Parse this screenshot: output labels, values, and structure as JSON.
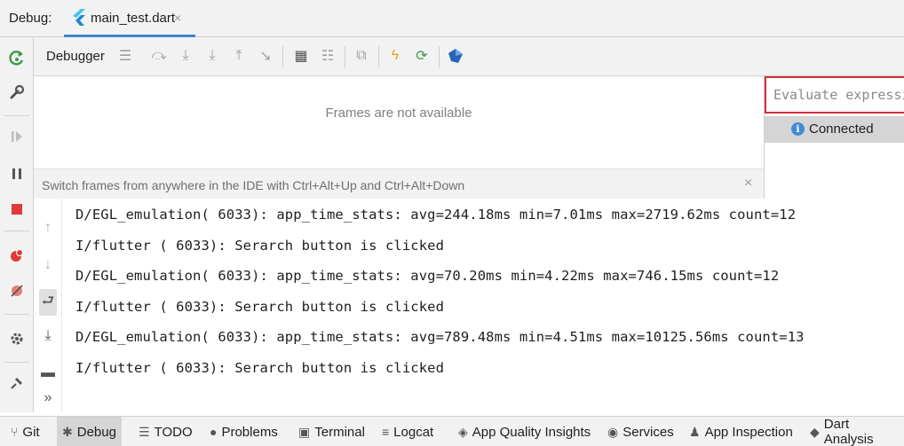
{
  "header": {
    "title": "Debug:",
    "tab_label": "main_test.dart",
    "tab_close": "×"
  },
  "toolbar": {
    "label": "Debugger",
    "icons": [
      "menu-icon",
      "step-over-icon",
      "step-into-icon",
      "force-step-into-icon",
      "step-out-icon",
      "run-to-cursor-icon",
      "evaluate-icon",
      "trace-icon",
      "restore-layout-icon",
      "hot-reload-icon",
      "hot-restart-icon",
      "devtools-icon"
    ]
  },
  "frames": {
    "message": "Frames are not available",
    "hint": "Switch frames from anywhere in the IDE with Ctrl+Alt+Up and Ctrl+Alt+Down",
    "hint_close": "×"
  },
  "evaluate": {
    "placeholder": "Evaluate expression",
    "status": "Connected",
    "status_icon": "i"
  },
  "console": {
    "lines": [
      "D/EGL_emulation( 6033): app_time_stats: avg=244.18ms min=7.01ms max=2719.62ms count=12",
      "I/flutter ( 6033): Serarch button is clicked",
      "D/EGL_emulation( 6033): app_time_stats: avg=70.20ms min=4.22ms max=746.15ms count=12",
      "I/flutter ( 6033): Serarch button is clicked",
      "D/EGL_emulation( 6033): app_time_stats: avg=789.48ms min=4.51ms max=10125.56ms count=13",
      "I/flutter ( 6033): Serarch button is clicked"
    ],
    "more": "»"
  },
  "bottom_bar": {
    "items": [
      {
        "label": "Git",
        "icon": "git-icon"
      },
      {
        "label": "Debug",
        "icon": "debug-icon"
      },
      {
        "label": "TODO",
        "icon": "todo-icon"
      },
      {
        "label": "Problems",
        "icon": "problems-icon"
      },
      {
        "label": "Terminal",
        "icon": "terminal-icon"
      },
      {
        "label": "Logcat",
        "icon": "logcat-icon"
      },
      {
        "label": "App Quality Insights",
        "icon": "app-quality-icon"
      },
      {
        "label": "Services",
        "icon": "services-icon"
      },
      {
        "label": "App Inspection",
        "icon": "app-inspection-icon"
      },
      {
        "label": "Dart Analysis",
        "icon": "dart-analysis-icon"
      }
    ],
    "active": "Debug"
  },
  "colors": {
    "accent": "#4083c9",
    "eval_border": "#d0303a",
    "stop_red": "#e03b3b",
    "rerun_green": "#3e9a48",
    "lightning": "#f0a30a"
  }
}
